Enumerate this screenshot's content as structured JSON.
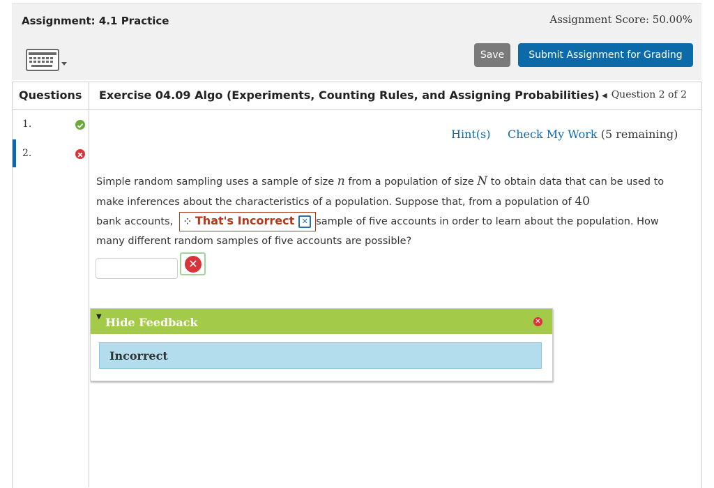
{
  "assignment": {
    "title": "Assignment: 4.1 Practice",
    "score": "Assignment Score: 50.00%"
  },
  "toolbar": {
    "save_label": "Save",
    "submit_label": "Submit Assignment for Grading",
    "keyboard_icon": "keyboard-icon"
  },
  "sidebar": {
    "header": "Questions",
    "items": [
      {
        "number": "1.",
        "status": "correct",
        "status_color": "#6aaa3a"
      },
      {
        "number": "2.",
        "status": "incorrect",
        "status_color": "#d9343a"
      }
    ]
  },
  "exercise": {
    "title": "Exercise 04.09 Algo (Experiments, Counting Rules, and Assigning Probabilities)",
    "nav": "Question 2 of 2"
  },
  "links": {
    "hint": "Hint(s)",
    "check": "Check My Work",
    "remaining": " (5 remaining)"
  },
  "question": {
    "p1": "Simple random sampling uses a sample of size ",
    "var_n": "n",
    "p2": " from a population of size ",
    "var_N": "N",
    "p3": " to obtain data that can be used to make inferences about the characteristics of a population. Suppose that, from a population of ",
    "num40": "40",
    "p4": " bank accounts, ",
    "p5": "sample of five accounts in order to learn about the population. How many different random samples of five accounts are possible?",
    "incorrect_tag": "That's Incorrect"
  },
  "answer": {
    "value": ""
  },
  "feedback": {
    "toggle_label": "Hide Feedback",
    "message": "Incorrect"
  },
  "colors": {
    "accent": "#0d6aa8",
    "feedback_green": "#a4ca4a",
    "feedback_blue": "#b3dcec",
    "error": "#d9343a"
  }
}
